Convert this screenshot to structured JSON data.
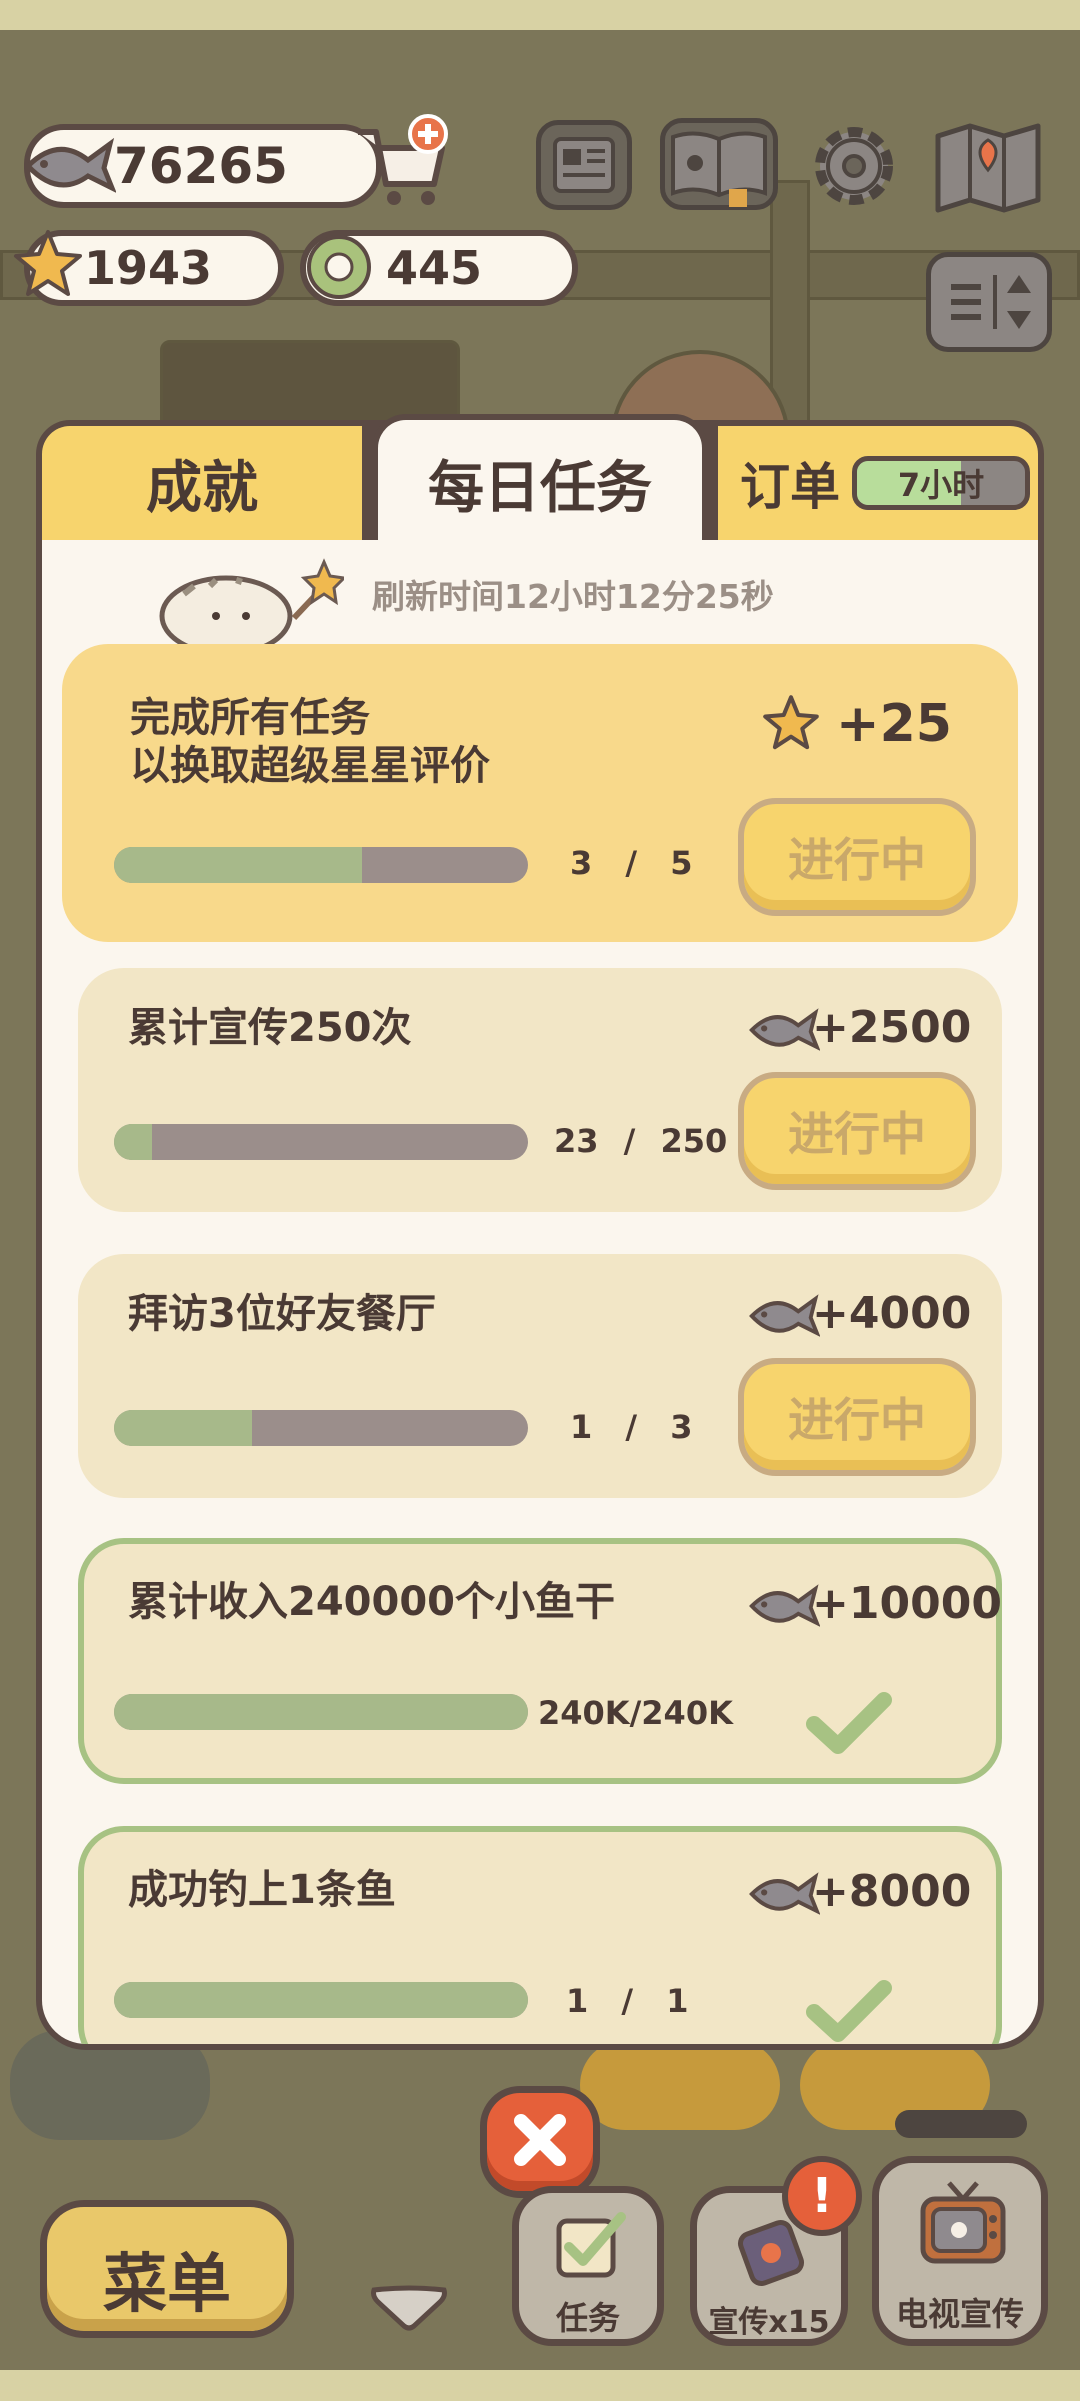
{
  "currency": {
    "fish": "76265",
    "stars": "1943",
    "coins": "445"
  },
  "icons": {
    "fish": "fish-icon",
    "cart": "shop-cart-icon",
    "newspaper": "newspaper-icon",
    "book": "catalog-book-icon",
    "gear": "gear-icon",
    "map": "map-icon",
    "sliders": "layout-toggle-icon",
    "star": "star-icon",
    "coin": "ring-coin-icon",
    "close": "close-icon",
    "check": "check-icon",
    "tv": "tv-icon"
  },
  "tabs": {
    "achievements": "成就",
    "daily": "每日任务",
    "orders": "订单",
    "orders_timer": "7小时"
  },
  "refresh_text": "刷新时间12小时12分25秒",
  "tasks": [
    {
      "title": "完成所有任务\n以换取超级星星评价",
      "reward": "+25",
      "reward_icon": "star",
      "current": "3",
      "total": "5",
      "progress": 0.6,
      "status": "进行中"
    },
    {
      "title": "累计宣传250次",
      "reward": "+2500",
      "reward_icon": "fish",
      "current": "23",
      "total": "250",
      "progress": 0.092,
      "status": "进行中"
    },
    {
      "title": "拜访3位好友餐厅",
      "reward": "+4000",
      "reward_icon": "fish",
      "current": "1",
      "total": "3",
      "progress": 0.333,
      "status": "进行中"
    },
    {
      "title": "累计收入240000个小鱼干",
      "reward": "+10000",
      "reward_icon": "fish",
      "count_text": "240K/240K",
      "progress": 1.0,
      "status": "done"
    },
    {
      "title": "成功钓上1条鱼",
      "reward": "+8000",
      "reward_icon": "fish",
      "current": "1",
      "total": "1",
      "progress": 1.0,
      "status": "done"
    }
  ],
  "hud": {
    "menu": "菜单",
    "tasks": "任务",
    "promote": "宣传x15",
    "tv_promote": "电视宣传",
    "alert": "!"
  },
  "colors": {
    "accent_yellow": "#f7d46d",
    "progress_green": "#a7b98a",
    "done_border": "#a7c283",
    "close_red": "#e5603a"
  }
}
